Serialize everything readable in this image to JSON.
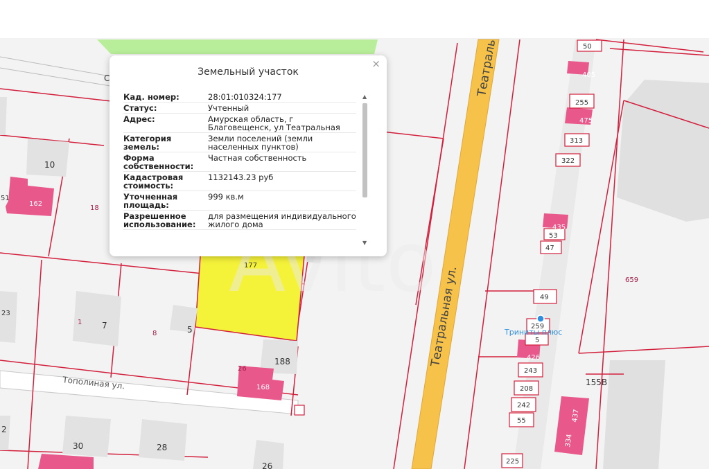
{
  "popup": {
    "title": "Земельный участок",
    "close_icon": "close-icon",
    "rows": [
      {
        "key": "Кад. номер:",
        "value": "28:01:010324:177"
      },
      {
        "key": "Статус:",
        "value": "Учтенный"
      },
      {
        "key": "Адрес:",
        "value": "Амурская область, г Благовещенск, ул Театральная"
      },
      {
        "key": "Категория земель:",
        "value": "Земли поселений (земли населенных пунктов)"
      },
      {
        "key": "Форма собственности:",
        "value": "Частная собственность"
      },
      {
        "key": "Кадастровая стоимость:",
        "value": "1132143.23 руб"
      },
      {
        "key": "Уточненная площадь:",
        "value": "999 кв.м"
      },
      {
        "key": "Разрешенное использование:",
        "value": "для размещения индивидуального жилого дома"
      }
    ]
  },
  "map": {
    "streets": {
      "teatralnaya_top": "Театраль",
      "teatralnaya": "Театральная ул.",
      "topolinaya": "Тополиная ул."
    },
    "poi": "Триниты плюс",
    "parcels": {
      "p50": "50",
      "p405": "405",
      "p255": "255",
      "p475": "475",
      "p313": "313",
      "p322": "322",
      "p435": "435",
      "p53": "53",
      "p47": "47",
      "p49": "49",
      "p259": "259",
      "p5b": "5",
      "p426": "426",
      "p243": "243",
      "p208": "208",
      "p242": "242",
      "p55": "55",
      "p225": "225",
      "p155v": "155В",
      "p437": "437",
      "p334": "334",
      "p659": "659",
      "p10": "10",
      "p162": "162",
      "p51": "51",
      "p18": "18",
      "p23": "23",
      "p1": "1",
      "p7": "7",
      "p8": "8",
      "p5": "5",
      "p177": "177",
      "p188": "188",
      "p26": "26",
      "p168": "168",
      "p2": "2",
      "p30": "30",
      "p28": "28",
      "p26b": "26",
      "pC": "С"
    },
    "colors": {
      "parcel_line": "#d21f3c",
      "selected_parcel": "#f5f23a",
      "building": "#e6e6e6",
      "building_pink": "#e8588a",
      "road": "#f6c24a",
      "park": "#b8ee9a"
    }
  }
}
